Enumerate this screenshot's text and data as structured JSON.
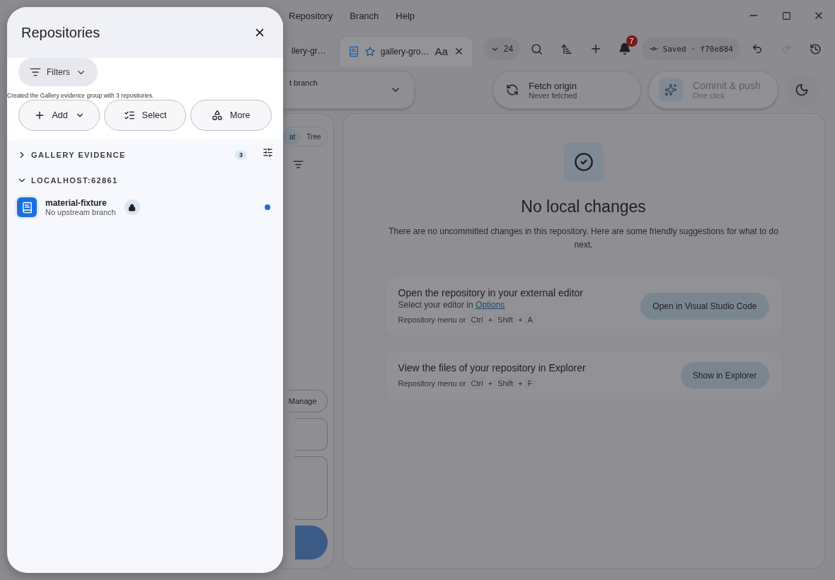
{
  "menu": [
    "Repository",
    "Branch",
    "Help"
  ],
  "tabs": [
    {
      "label": "llery-gr…",
      "selected": false
    },
    {
      "label": "gallery-gro…",
      "selected": true,
      "font_button": "Aa"
    }
  ],
  "toolbar": {
    "history_count": "24",
    "notifications": "7",
    "saved": "Saved · f70e884"
  },
  "branch": {
    "label": "t branch"
  },
  "fetch": {
    "title": "Fetch origin",
    "subtitle": "Never fetched"
  },
  "commit": {
    "title": "Commit & push",
    "subtitle": "One click",
    "disabled": true
  },
  "view_toggle": [
    {
      "label": "at",
      "selected": true
    },
    {
      "label": "Tree",
      "selected": false
    }
  ],
  "manage": "Manage",
  "empty": {
    "title": "No local changes",
    "text": "There are no uncommitted changes in this repository. Here are some friendly suggestions for what to do next.",
    "actions": [
      {
        "title": "Open the repository in your external editor",
        "subtitle": "Select your editor in",
        "link": "Options",
        "shortcut_prefix": "Repository menu or",
        "keys": [
          "Ctrl",
          "Shift",
          "A"
        ],
        "button": "Open in Visual Studio Code"
      },
      {
        "title": "View the files of your repository in Explorer",
        "shortcut_prefix": "Repository menu or",
        "keys": [
          "Ctrl",
          "Shift",
          "F"
        ],
        "button": "Show in Explorer"
      }
    ],
    "key_joiner": "+"
  },
  "drawer": {
    "title": "Repositories",
    "filters": "Filters",
    "message": "Created the Gallery evidence group with 3 repositories.",
    "buttons": [
      {
        "label": "Add",
        "kind": "add"
      },
      {
        "label": "Select",
        "kind": "select"
      },
      {
        "label": "More",
        "kind": "more"
      }
    ],
    "groups": [
      {
        "name": "GALLERY EVIDENCE",
        "expanded": false,
        "count": "3"
      },
      {
        "name": "LOCALHOST:62861",
        "expanded": true,
        "repos": [
          {
            "name": "material-fixture",
            "subtitle": "No upstream branch",
            "locked": true,
            "current": true
          }
        ]
      }
    ]
  }
}
